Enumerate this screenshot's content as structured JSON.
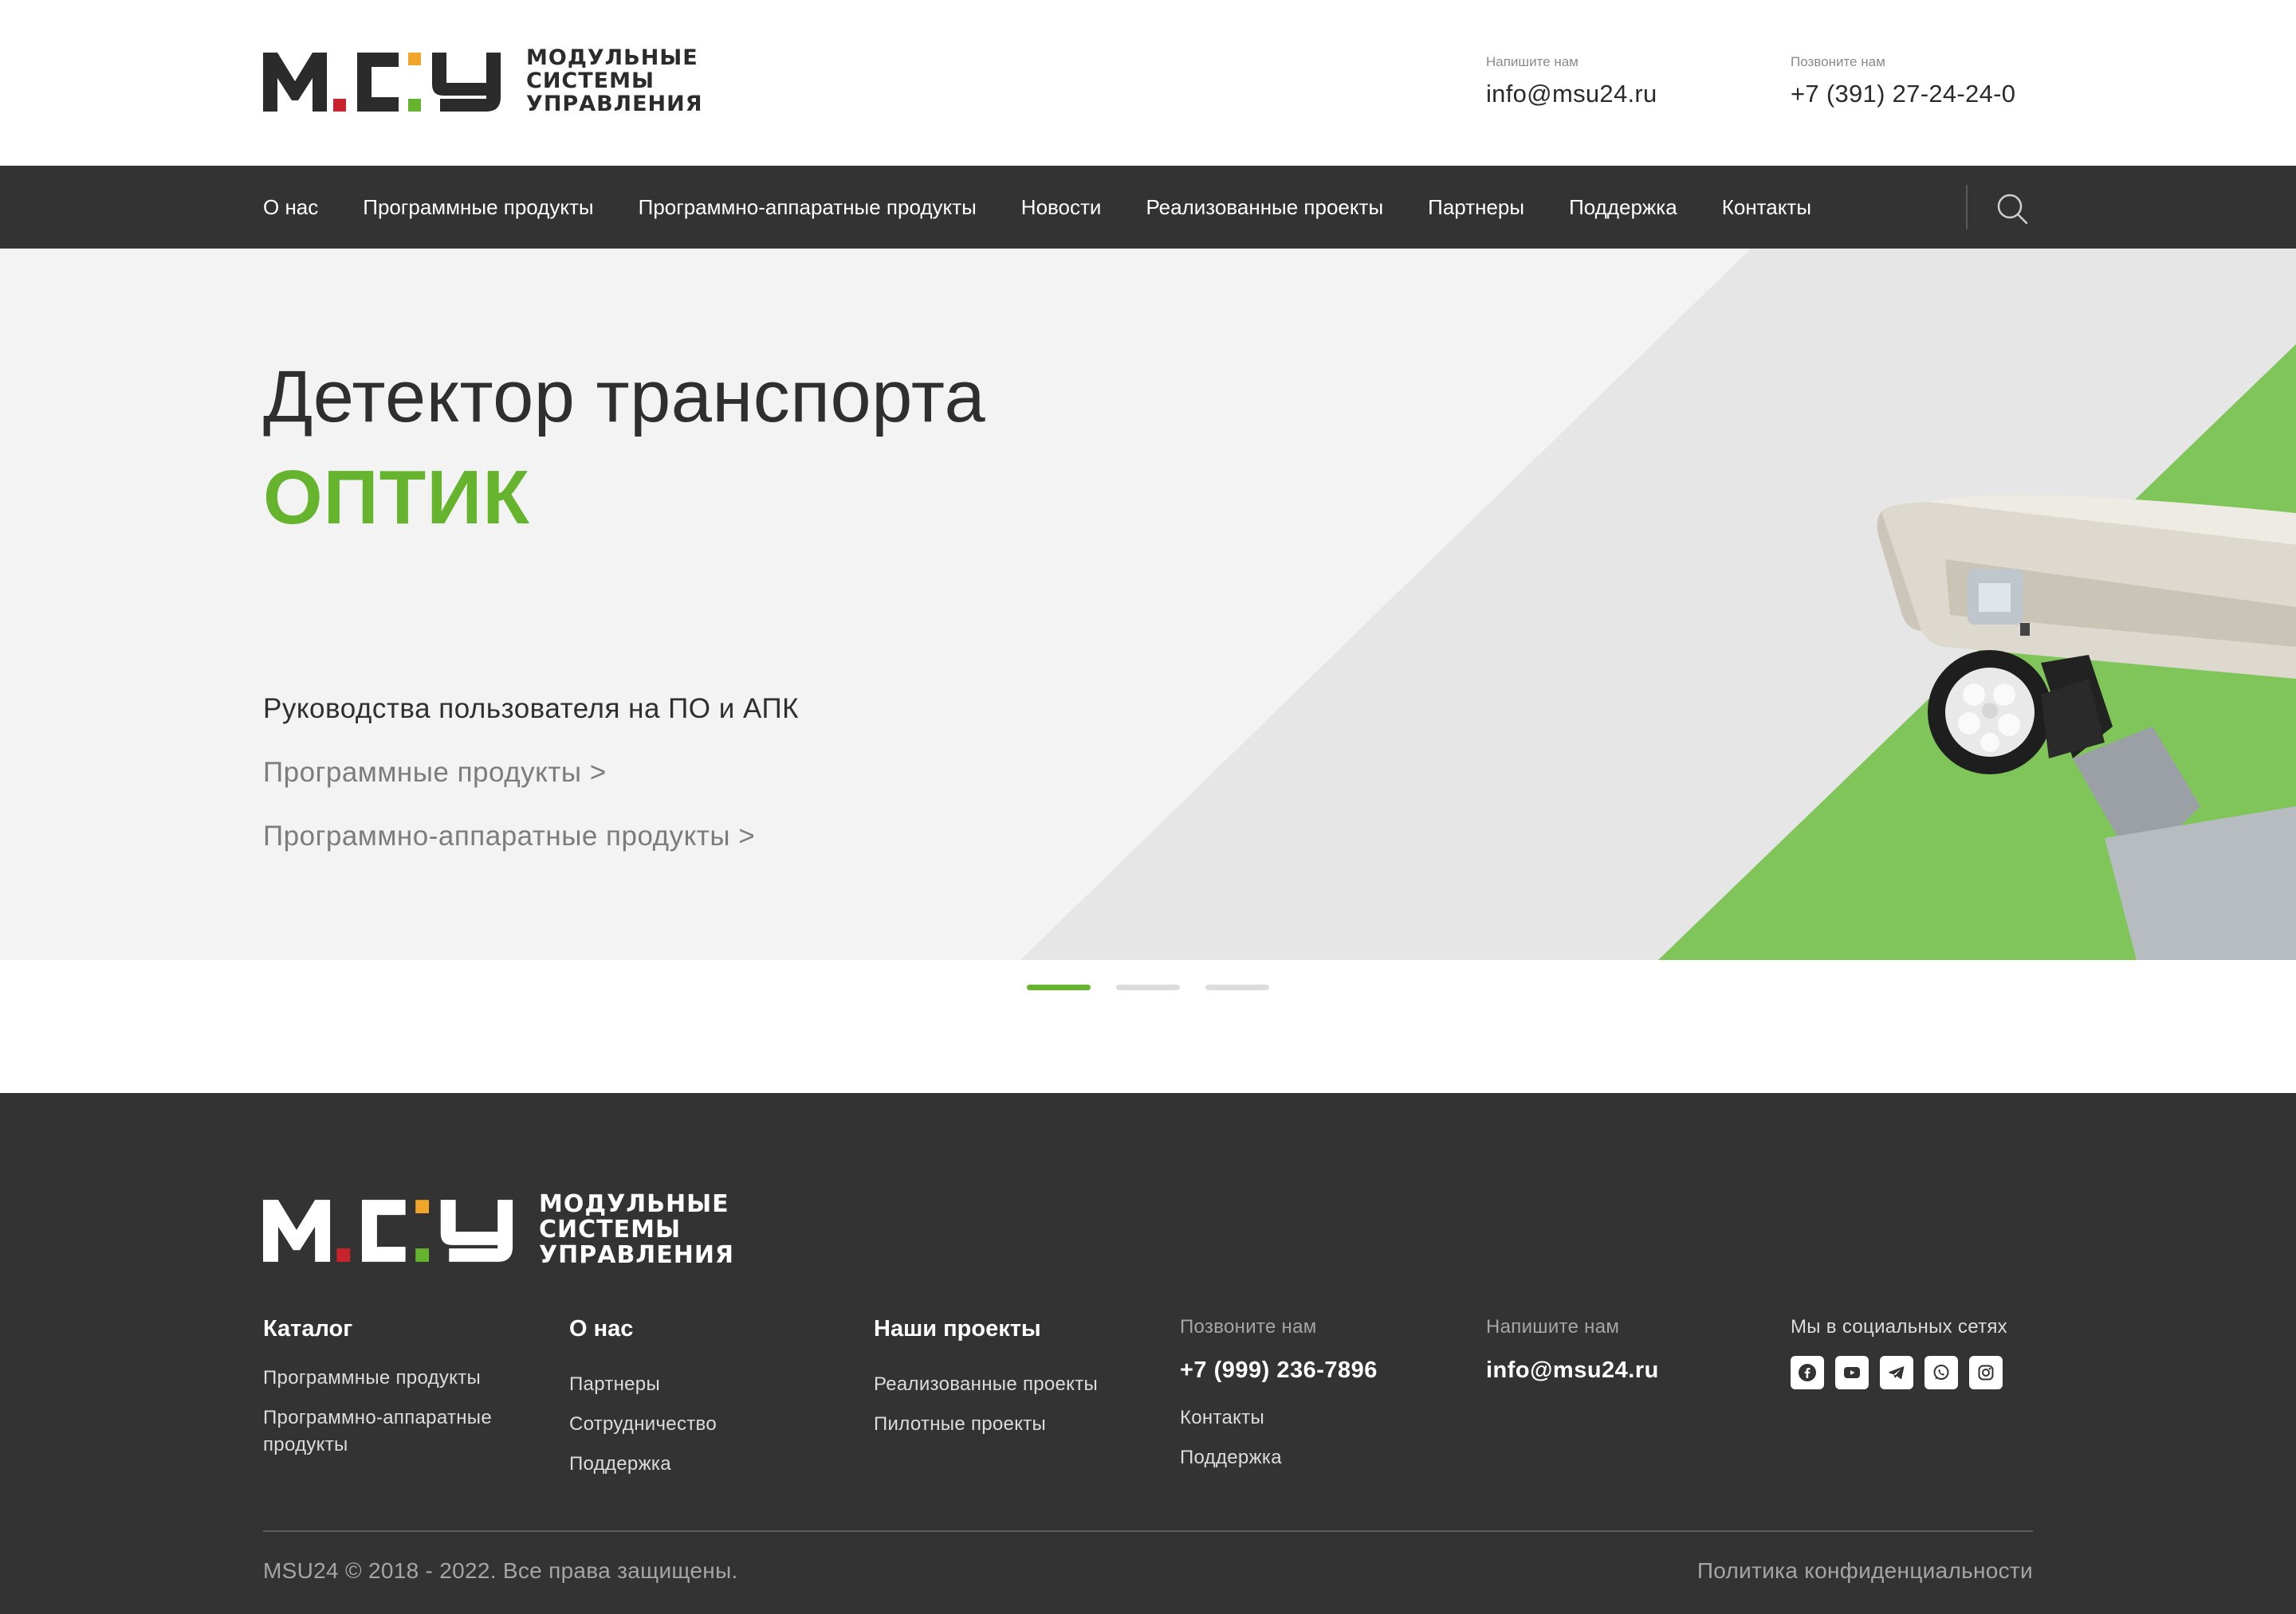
{
  "header": {
    "logo_text_lines": [
      "МОДУЛЬНЫЕ",
      "СИСТЕМЫ",
      "УПРАВЛЕНИЯ"
    ],
    "email_label": "Напишите нам",
    "email": "info@msu24.ru",
    "phone_label": "Позвоните нам",
    "phone": "+7 (391) 27-24-24-0"
  },
  "nav": {
    "items": [
      {
        "label": "О нас"
      },
      {
        "label": "Программные продукты"
      },
      {
        "label": "Программно-аппаратные продукты"
      },
      {
        "label": "Новости"
      },
      {
        "label": "Реализованные проекты"
      },
      {
        "label": "Партнеры"
      },
      {
        "label": "Поддержка"
      },
      {
        "label": "Контакты"
      }
    ],
    "search_icon": "search-icon"
  },
  "hero": {
    "title": "Детектор транспорта",
    "accent": "ОПТИК",
    "subtitle": "Руководства пользователя на ПО и АПК",
    "links": [
      "Программные продукты >",
      "Программно-аппаратные продукты >"
    ],
    "image": "camera-image"
  },
  "slider": {
    "count": 3,
    "active_index": 0
  },
  "footer": {
    "logo_text_lines": [
      "МОДУЛЬНЫЕ",
      "СИСТЕМЫ",
      "УПРАВЛЕНИЯ"
    ],
    "catalog": {
      "heading": "Каталог",
      "links": [
        "Программные продукты",
        "Программно-аппаратные продукты"
      ]
    },
    "about": {
      "heading": "О нас",
      "links": [
        "Партнеры",
        "Сотрудничество",
        "Поддержка"
      ]
    },
    "projects": {
      "heading": "Наши проекты",
      "links": [
        "Реализованные проекты",
        "Пилотные проекты"
      ]
    },
    "call": {
      "label": "Позвоните нам",
      "phone": "+7 (999) 236-7896",
      "links": [
        "Контакты",
        "Поддержка"
      ]
    },
    "write": {
      "label": "Напишите нам",
      "email": "info@msu24.ru"
    },
    "social": {
      "label": "Мы в социальных сетях",
      "icons": [
        "facebook-icon",
        "youtube-icon",
        "telegram-icon",
        "whatsapp-icon",
        "instagram-icon"
      ]
    },
    "copyright": "MSU24 © 2018 - 2022. Все права защищены.",
    "privacy": "Политика конфиденциальности"
  },
  "colors": {
    "accent_green": "#66b32e",
    "dark": "#333333",
    "logo_orange": "#f0a52b",
    "logo_red": "#c8232c",
    "logo_green": "#66b32e"
  }
}
